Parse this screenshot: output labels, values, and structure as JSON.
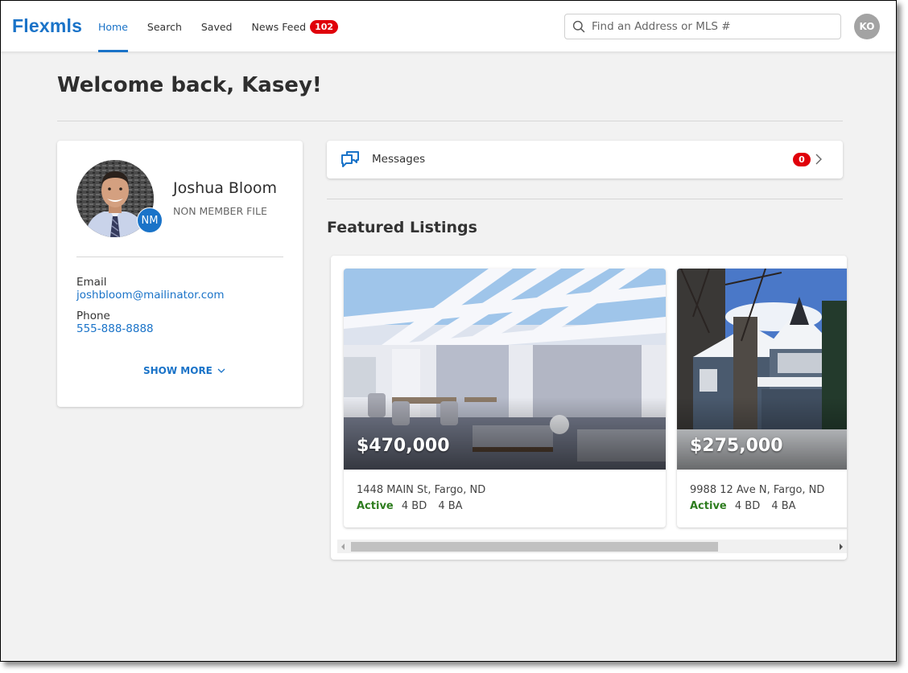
{
  "header": {
    "logo": "Flexmls",
    "nav": [
      {
        "label": "Home",
        "active": true
      },
      {
        "label": "Search",
        "active": false
      },
      {
        "label": "Saved",
        "active": false
      },
      {
        "label": "News Feed",
        "active": false,
        "badge": "102"
      }
    ],
    "search": {
      "placeholder": "Find an Address or MLS #",
      "value": "",
      "icon": "search-icon"
    },
    "user_initials": "KO"
  },
  "page": {
    "welcome": "Welcome back, Kasey!"
  },
  "profile": {
    "name": "Joshua Bloom",
    "subtitle": "NON MEMBER FILE",
    "badge": "NM",
    "email_label": "Email",
    "email": "joshbloom@mailinator.com",
    "phone_label": "Phone",
    "phone": "555-888-8888",
    "show_more": "SHOW MORE"
  },
  "messages": {
    "label": "Messages",
    "count": "0",
    "icon": "chat-bubbles-icon"
  },
  "featured": {
    "title": "Featured Listings",
    "listings": [
      {
        "price": "$470,000",
        "address": "1448 MAIN St, Fargo, ND",
        "status": "Active",
        "beds": "4 BD",
        "baths": "4 BA",
        "image": "patio-photo"
      },
      {
        "price": "$275,000",
        "address": "9988 12 Ave N, Fargo, ND",
        "status": "Active",
        "beds": "4 BD",
        "baths": "4 BA",
        "image": "victorian-house-photo"
      }
    ],
    "scroll_position": 0
  },
  "colors": {
    "brand": "#1a73c8",
    "badge": "#e0000a",
    "active_status": "#2e7d1f",
    "background": "#f2f2f2"
  }
}
